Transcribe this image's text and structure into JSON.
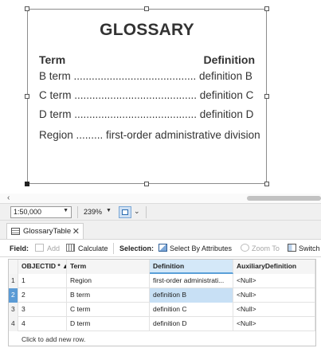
{
  "glossary": {
    "title": "GLOSSARY",
    "term_header": "Term",
    "definition_header": "Definition",
    "rows": [
      {
        "text": "B term ......................................... definition B"
      },
      {
        "text": "C term ......................................... definition C"
      },
      {
        "text": "D term ......................................... definition D"
      },
      {
        "text": "Region ......... first-order administrative division"
      }
    ]
  },
  "statusbar": {
    "scale": "1:50,000",
    "zoom": "239%"
  },
  "tab": {
    "label": "GlossaryTable"
  },
  "toolbar": {
    "field_label": "Field:",
    "add_label": "Add",
    "calculate_label": "Calculate",
    "selection_label": "Selection:",
    "select_by_attributes_label": "Select By Attributes",
    "zoom_to_label": "Zoom To",
    "switch_label": "Switch"
  },
  "table": {
    "columns": [
      "OBJECTID * ▲",
      "Term",
      "Definition",
      "AuxiliaryDefinition"
    ],
    "rows": [
      {
        "num": "1",
        "objectid": "1",
        "term": "Region",
        "definition": "first-order administrati...",
        "aux": "<Null>"
      },
      {
        "num": "2",
        "objectid": "2",
        "term": "B term",
        "definition": "definition B",
        "aux": "<Null>"
      },
      {
        "num": "3",
        "objectid": "3",
        "term": "C term",
        "definition": "definition C",
        "aux": "<Null>"
      },
      {
        "num": "4",
        "objectid": "4",
        "term": "D term",
        "definition": "definition D",
        "aux": "<Null>"
      }
    ],
    "add_row_text": "Click to add new row."
  },
  "colors": {
    "selection_blue": "#c8e0f5",
    "selected_row_header": "#5b9bd5",
    "active_column_header": "#d4e8f8"
  }
}
